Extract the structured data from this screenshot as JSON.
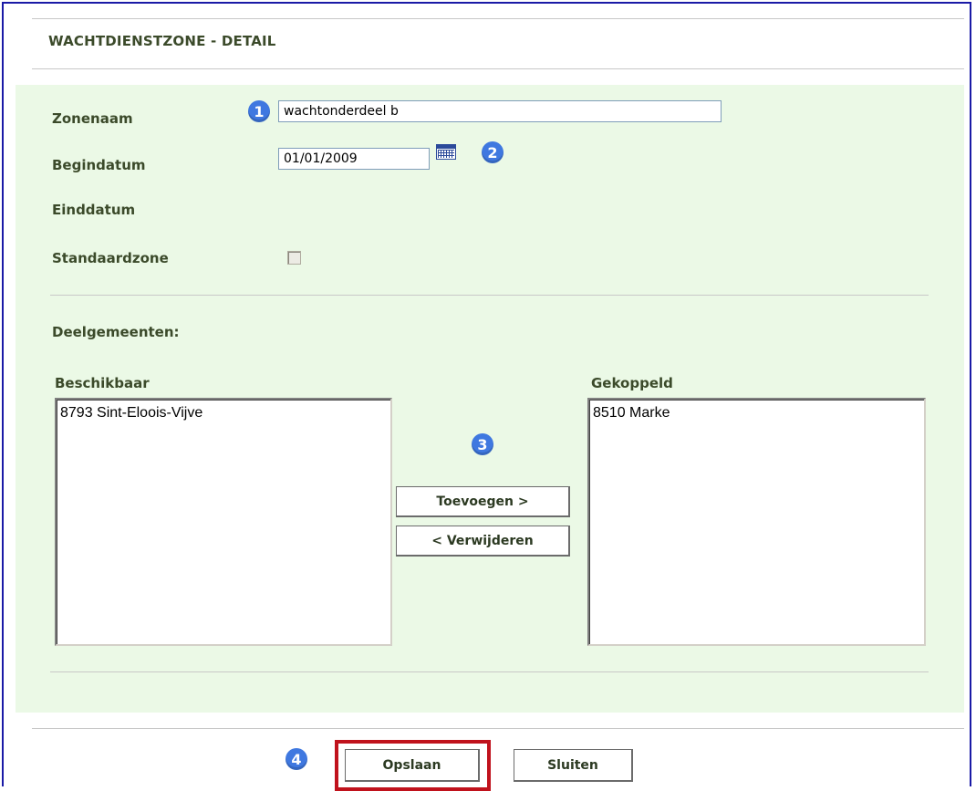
{
  "header": {
    "title": "WACHTDIENSTZONE - DETAIL"
  },
  "form": {
    "zonenaam_label": "Zonenaam",
    "zonenaam_value": "wachtonderdeel b",
    "begindatum_label": "Begindatum",
    "begindatum_value": "01/01/2009",
    "einddatum_label": "Einddatum",
    "standaardzone_label": "Standaardzone",
    "standaardzone_checked": false
  },
  "deelgemeenten": {
    "section_label": "Deelgemeenten:",
    "available_label": "Beschikbaar",
    "available_items": [
      "8793 Sint-Eloois-Vijve"
    ],
    "linked_label": "Gekoppeld",
    "linked_items": [
      "8510 Marke"
    ],
    "add_button": "Toevoegen >",
    "remove_button": "< Verwijderen"
  },
  "footer": {
    "save_button": "Opslaan",
    "close_button": "Sluiten"
  },
  "badges": {
    "b1": "1",
    "b2": "2",
    "b3": "3",
    "b4": "4"
  },
  "colors": {
    "panel_bg": "#ebf9e6",
    "badge_blue": "#3f78e0",
    "highlight_red": "#c0121c",
    "label_text": "#3b4a2a"
  },
  "icons": {
    "calendar": "calendar-icon",
    "badge": "numbered-step-badge-icon"
  }
}
